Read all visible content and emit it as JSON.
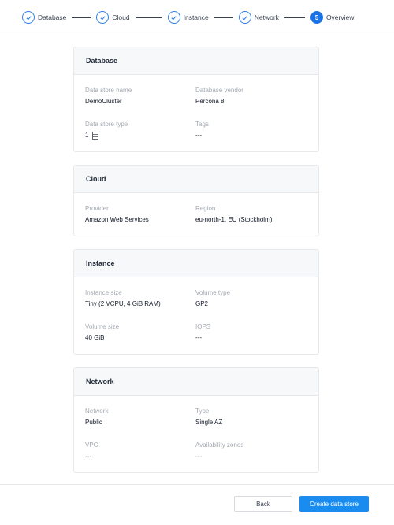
{
  "stepper": {
    "steps": [
      {
        "label": "Database",
        "state": "done"
      },
      {
        "label": "Cloud",
        "state": "done"
      },
      {
        "label": "Instance",
        "state": "done"
      },
      {
        "label": "Network",
        "state": "done"
      },
      {
        "label": "Overview",
        "state": "current",
        "number": "5"
      }
    ]
  },
  "cards": {
    "database": {
      "title": "Database",
      "store_name_label": "Data store name",
      "store_name": "DemoCluster",
      "vendor_label": "Database vendor",
      "vendor": "Percona 8",
      "type_label": "Data store type",
      "type": "1",
      "type_icon": "database-server-icon",
      "tags_label": "Tags",
      "tags": "---"
    },
    "cloud": {
      "title": "Cloud",
      "provider_label": "Provider",
      "provider": "Amazon Web Services",
      "region_label": "Region",
      "region": "eu-north-1, EU (Stockholm)"
    },
    "instance": {
      "title": "Instance",
      "size_label": "Instance size",
      "size": "Tiny (2 VCPU, 4 GiB RAM)",
      "volume_type_label": "Volume type",
      "volume_type": "GP2",
      "volume_size_label": "Volume size",
      "volume_size": "40 GiB",
      "iops_label": "IOPS",
      "iops": "---"
    },
    "network": {
      "title": "Network",
      "network_label": "Network",
      "network": "Public",
      "type_label": "Type",
      "type": "Single AZ",
      "vpc_label": "VPC",
      "vpc": "---",
      "az_label": "Availability zones",
      "az": "---"
    }
  },
  "footer": {
    "back_label": "Back",
    "create_label": "Create data store"
  },
  "colors": {
    "accent": "#1a8cf0",
    "step_done": "#2f7fe8",
    "label_muted": "#a3a9b1"
  }
}
